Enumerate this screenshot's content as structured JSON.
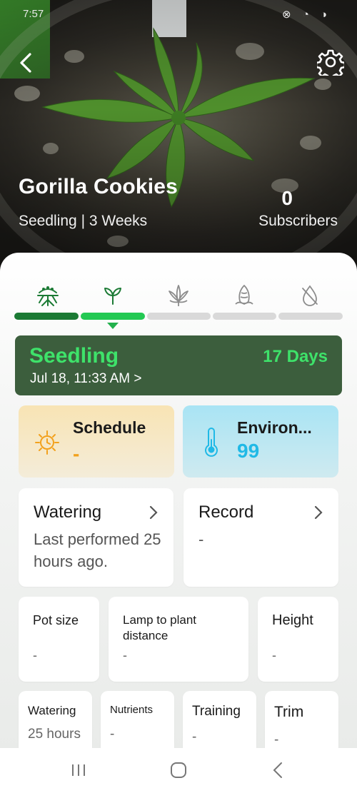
{
  "status_bar": {
    "time": "7:57",
    "icons": "⊗ ◔ ◑"
  },
  "plant": {
    "name": "Gorilla Cookies",
    "subtitle": "Seedling | 3 Weeks"
  },
  "subscribers": {
    "count": "0",
    "label": "Subscribers"
  },
  "stages": {
    "icons": [
      "germination-icon",
      "seedling-icon",
      "vegetative-leaf-icon",
      "flowering-bud-icon",
      "drying-icon"
    ],
    "current_index": 1,
    "colors": {
      "done": "#1b7a34",
      "active": "#23c953",
      "upcoming": "#d9d9d9"
    }
  },
  "stage_card": {
    "name": "Seedling",
    "days": "17 Days",
    "date": "Jul 18, 11:33 AM >"
  },
  "schedule": {
    "title": "Schedule",
    "value": "-"
  },
  "environment": {
    "title": "Environ...",
    "value": "99"
  },
  "watering_card": {
    "title": "Watering",
    "body": "Last performed 25 hours ago."
  },
  "record_card": {
    "title": "Record",
    "body": "-"
  },
  "metrics": [
    {
      "title": "Pot size",
      "value": "-"
    },
    {
      "title": "Lamp to plant distance",
      "value": "-"
    },
    {
      "title": "Height",
      "value": "-"
    }
  ],
  "bottom_cards": [
    {
      "title": "Watering",
      "value": "25 hours"
    },
    {
      "title": "Nutrients",
      "value": "-"
    },
    {
      "title": "Training",
      "value": "-"
    },
    {
      "title": "Trim",
      "value": "-"
    }
  ]
}
